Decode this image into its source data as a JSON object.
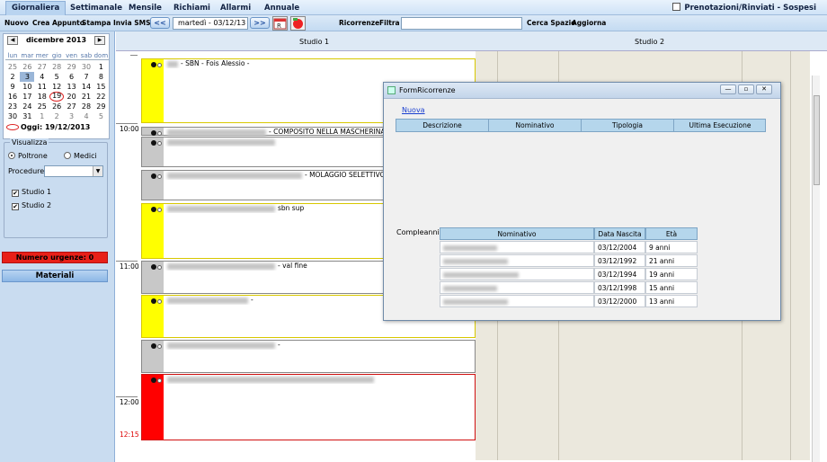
{
  "tabs": {
    "items": [
      "Giornaliera",
      "Settimanale",
      "Mensile",
      "Richiami",
      "Allarmi",
      "Annuale"
    ],
    "active": "Giornaliera",
    "prenotazioni_label": "Prenotazioni/Rinviati - Sospesi"
  },
  "toolbar": {
    "nuovo": "Nuovo",
    "crea_appunto": "Crea Appunto",
    "stampa": "Stampa",
    "invia_sms": "Invia SMS",
    "prev": "<<",
    "next": ">>",
    "date": "martedì - 03/12/13",
    "ricorrenze": "Ricorrenze",
    "filtra": "Filtra",
    "filter_value": "",
    "cerca_spazio": "Cerca Spazio",
    "aggiorna": "Aggiorna"
  },
  "calendar": {
    "title": "dicembre 2013",
    "dows": [
      "lun",
      "mar",
      "mer",
      "gio",
      "ven",
      "sab",
      "dom"
    ],
    "weeks": [
      [
        "25",
        "26",
        "27",
        "28",
        "29",
        "30",
        "1"
      ],
      [
        "2",
        "3",
        "4",
        "5",
        "6",
        "7",
        "8"
      ],
      [
        "9",
        "10",
        "11",
        "12",
        "13",
        "14",
        "15"
      ],
      [
        "16",
        "17",
        "18",
        "19",
        "20",
        "21",
        "22"
      ],
      [
        "23",
        "24",
        "25",
        "26",
        "27",
        "28",
        "29"
      ],
      [
        "30",
        "31",
        "1",
        "2",
        "3",
        "4",
        "5"
      ]
    ],
    "selected": "3",
    "today": "19",
    "today_label": "Oggi: 19/12/2013"
  },
  "visualizza": {
    "legend": "Visualizza",
    "poltrone": "Poltrone",
    "medici": "Medici",
    "procedure_label": "Procedure",
    "studio1": "Studio 1",
    "studio2": "Studio 2"
  },
  "urgenze": "Numero urgenze: 0",
  "materiali": "Materiali",
  "schedule": {
    "col1": "Studio 1",
    "col2": "Studio 2",
    "times": [
      "10:00",
      "11:00",
      "12:00",
      "12:15"
    ],
    "appointments": [
      {
        "text": "- SBN - Fois Alessio -",
        "color": "#ffff00"
      },
      {
        "text": "- COMPOSITO NELLA MASCHERINA ?",
        "color": "#c8c8c8"
      },
      {
        "text": "",
        "color": "#c8c8c8"
      },
      {
        "text": "- MOLAGGIO SELETTIVO",
        "color": "#c8c8c8"
      },
      {
        "text": "sbn sup",
        "color": "#ffff00"
      },
      {
        "text": "- val fine",
        "color": "#c8c8c8"
      },
      {
        "text": "-",
        "color": "#ffff00"
      },
      {
        "text": "-",
        "color": "#c8c8c8"
      },
      {
        "text": "",
        "color": "#ff0000"
      }
    ]
  },
  "modal": {
    "title": "FormRicorrenze",
    "nuova": "Nuova",
    "rec_headers": [
      "Descrizione",
      "Nominativo",
      "Tipologia",
      "Ultima Esecuzione"
    ],
    "compleanni_label": "Compleanni",
    "bday_headers": [
      "Nominativo",
      "Data Nascita",
      "Età"
    ],
    "bday_rows": [
      {
        "date": "03/12/2004",
        "age": "9 anni"
      },
      {
        "date": "03/12/1992",
        "age": "21 anni"
      },
      {
        "date": "03/12/1994",
        "age": "19 anni"
      },
      {
        "date": "03/12/1998",
        "age": "15 anni"
      },
      {
        "date": "03/12/2000",
        "age": "13 anni"
      }
    ]
  }
}
